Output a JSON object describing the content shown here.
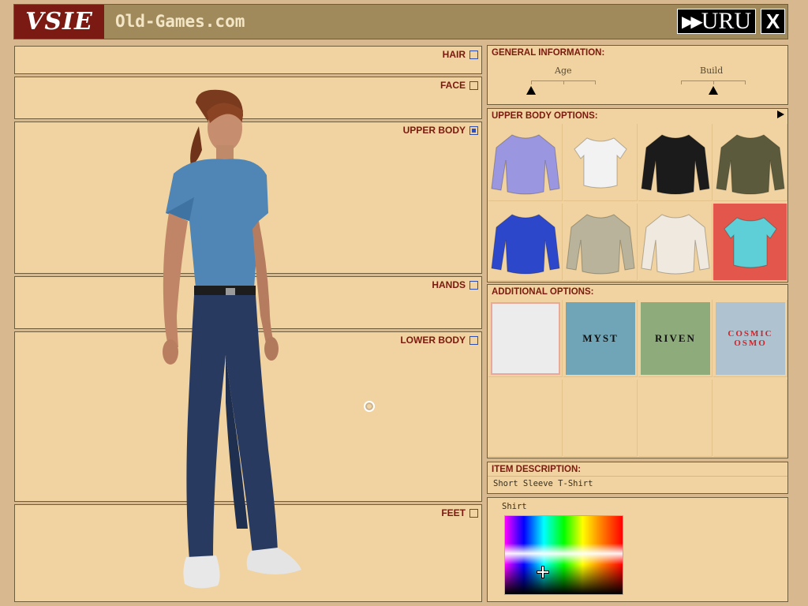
{
  "header": {
    "logo_text": "VSIE",
    "site_title": "Old-Games.com",
    "uru_label": "URU",
    "uru_arrows": "▶▶",
    "close_label": "X"
  },
  "regions": [
    {
      "key": "hair",
      "label": "HAIR",
      "checked": false
    },
    {
      "key": "face",
      "label": "FACE",
      "checked": false
    },
    {
      "key": "upper_body",
      "label": "UPPER BODY",
      "checked": true
    },
    {
      "key": "hands",
      "label": "HANDS",
      "checked": false
    },
    {
      "key": "lower_body",
      "label": "LOWER BODY",
      "checked": false
    },
    {
      "key": "feet",
      "label": "FEET",
      "checked": false
    }
  ],
  "general": {
    "title": "GENERAL INFORMATION:",
    "age_label": "Age",
    "age_value": 0.0,
    "build_label": "Build",
    "build_value": 0.5
  },
  "upper_body_options": {
    "title": "UPPER BODY OPTIONS:",
    "items": [
      {
        "name": "lavender-jacket",
        "color": "#9a96e0"
      },
      {
        "name": "white-tank-top",
        "color": "#f2f2f2"
      },
      {
        "name": "black-leather-jacket",
        "color": "#1b1b1b"
      },
      {
        "name": "olive-hoodie",
        "color": "#5b5a3c"
      },
      {
        "name": "blue-jacket",
        "color": "#2c47c9"
      },
      {
        "name": "grey-sweater",
        "color": "#b8b39a"
      },
      {
        "name": "white-long-sleeve",
        "color": "#efe9df"
      },
      {
        "name": "teal-tshirt",
        "color": "#5ecfd6",
        "selected": true
      }
    ]
  },
  "additional_options": {
    "title": "ADDITIONAL OPTIONS:",
    "items": [
      {
        "name": "blank",
        "label": "",
        "bg": "#ececec"
      },
      {
        "name": "myst-logo",
        "label": "MYST",
        "bg": "#6fa5b6"
      },
      {
        "name": "riven-logo",
        "label": "RIVEN",
        "bg": "#8eab7b"
      },
      {
        "name": "cosmic-osmo-logo",
        "label": "COSMIC OSMO",
        "bg": "#aec3cf"
      }
    ]
  },
  "item_description": {
    "title": "ITEM DESCRIPTION:",
    "text": "Short Sleeve T-Shirt"
  },
  "color_panel": {
    "label": "Shirt"
  }
}
